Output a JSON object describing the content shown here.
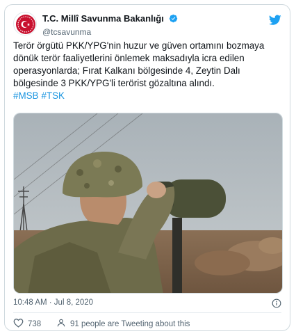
{
  "account": {
    "display_name": "T.C. Millî Savunma Bakanlığı",
    "handle": "@tcsavunma"
  },
  "tweet": {
    "lines": [
      "Terör örgütü PKK/YPG'nin huzur ve güven ortamını bozmaya",
      "dönük terör faaliyetlerini önlemek maksadıyla icra edilen",
      "operasyonlarda; Fırat Kalkanı bölgesinde 4, Zeytin Dalı",
      "bölgesinde 3 PKK/YPG'li terörist gözaltına alındı."
    ],
    "hashtags": [
      "#MSB",
      "#TSK"
    ],
    "timestamp": "10:48 AM · Jul 8, 2020"
  },
  "actions": {
    "like_count": "738",
    "tweeting_text": "91 people are Tweeting about this"
  },
  "colors": {
    "twitter_blue": "#1DA1F2",
    "like_red": "#e0245e",
    "hashtag": "#1b95e0",
    "emblem_red": "#c8102e"
  },
  "icons": [
    "verified-badge-icon",
    "twitter-bird-icon",
    "info-icon",
    "heart-icon",
    "person-icon"
  ]
}
